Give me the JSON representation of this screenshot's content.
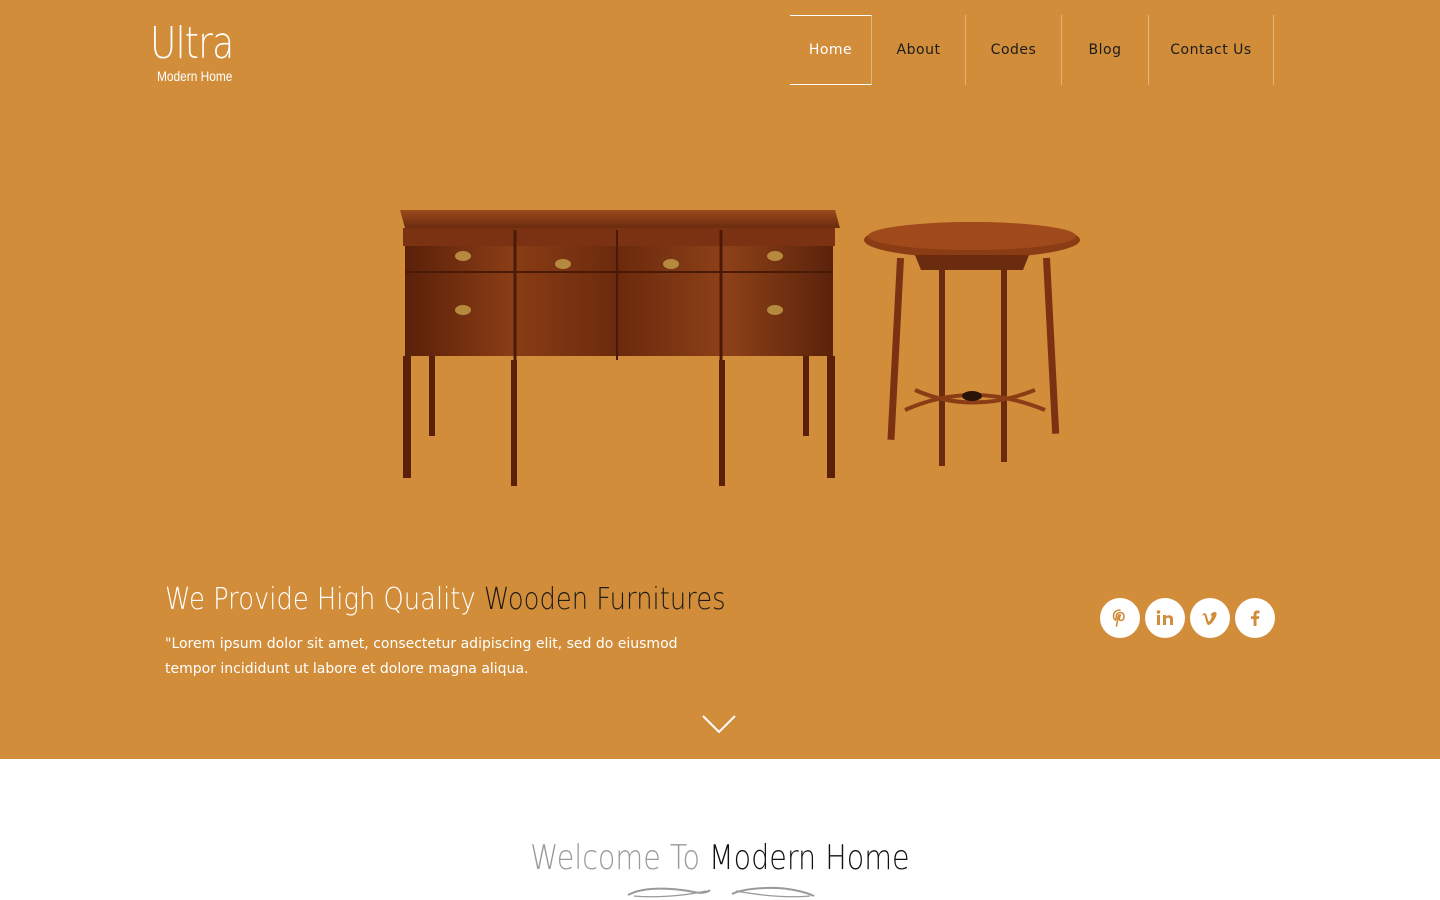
{
  "logo": {
    "title": "Ultra",
    "subtitle": "Modern Home"
  },
  "nav": {
    "items": [
      "Home",
      "About",
      "Codes",
      "Blog",
      "Contact Us"
    ],
    "active": "Home"
  },
  "hero": {
    "heading_light": "We Provide High Quality ",
    "heading_dark": "Wooden Furnitures",
    "description": "\"Lorem ipsum dolor sit amet, consectetur adipiscing elit, sed do eiusmod tempor incididunt ut labore et dolore magna aliqua."
  },
  "social": [
    {
      "icon": "pinterest-icon",
      "glyph": "P"
    },
    {
      "icon": "linkedin-icon",
      "glyph": "in"
    },
    {
      "icon": "vimeo-icon",
      "glyph": "v"
    },
    {
      "icon": "facebook-icon",
      "glyph": "f"
    }
  ],
  "welcome": {
    "title_grey": "Welcome To ",
    "title_black": "Modern Home"
  },
  "colors": {
    "accent": "#d18d3a",
    "dark_text": "#1d1a16",
    "grey_text": "#9a9a9a",
    "wood": "#7a3414"
  }
}
